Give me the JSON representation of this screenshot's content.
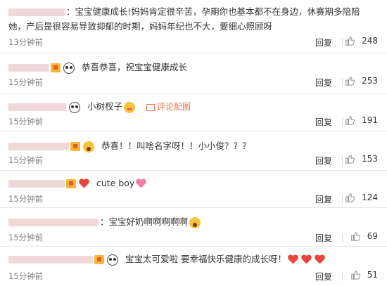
{
  "reply_label": "回复",
  "comments": [
    {
      "text": "：宝宝健康成长!妈妈肯定很辛苦，孕期你也基本都不在身边，休赛期多陪陪她，产后是很容易导致抑郁的时期，妈妈年纪也不大，要细心照顾呀",
      "time": "13分钟前",
      "likes": "248"
    },
    {
      "text": "恭喜恭喜，祝宝宝健康成长",
      "time": "15分钟前",
      "likes": "253"
    },
    {
      "text": "小树杈子",
      "pic_label": "评论配图",
      "time": "15分钟前",
      "likes": "191"
    },
    {
      "text": "恭喜！！叫啥名字呀！！小小俊？？？",
      "time": "15分钟前",
      "likes": "153"
    },
    {
      "text": "cute boy",
      "time": "15分钟前",
      "likes": "124"
    },
    {
      "text": "：宝宝好奶啊啊啊啊啊",
      "time": "15分钟前",
      "likes": "69"
    },
    {
      "text": "宝宝太可爱啦  要幸福快乐健康的成长呀！",
      "time": "15分钟前",
      "likes": "51"
    }
  ],
  "icons": {
    "like": "thumbs-up-icon",
    "vip": "vip-badge-icon",
    "panda": "panda-emoji-icon",
    "shy": "shy-emoji-icon",
    "heart": "heart-emoji-icon",
    "wow": "surprised-emoji-icon",
    "picture": "picture-icon"
  },
  "colors": {
    "link": "#eb7350",
    "heart": "#e8443a",
    "text": "#333333",
    "time": "#808080"
  }
}
